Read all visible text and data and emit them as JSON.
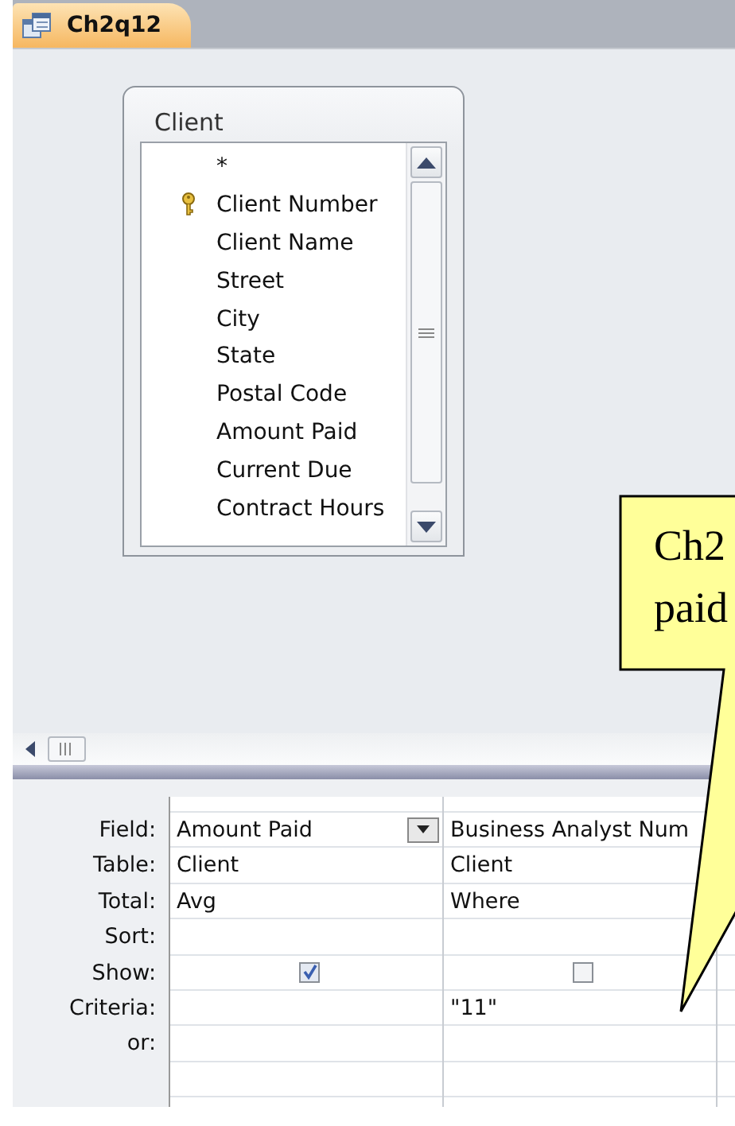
{
  "document_tab": {
    "title": "Ch2q12",
    "selected": true
  },
  "table_box": {
    "title": "Client",
    "fields": [
      {
        "name": "*",
        "primary_key": false
      },
      {
        "name": "Client Number",
        "primary_key": true
      },
      {
        "name": "Client Name",
        "primary_key": false
      },
      {
        "name": "Street",
        "primary_key": false
      },
      {
        "name": "City",
        "primary_key": false
      },
      {
        "name": "State",
        "primary_key": false
      },
      {
        "name": "Postal Code",
        "primary_key": false
      },
      {
        "name": "Amount Paid",
        "primary_key": false
      },
      {
        "name": "Current Due",
        "primary_key": false
      },
      {
        "name": "Contract Hours",
        "primary_key": false
      }
    ]
  },
  "callout": {
    "lines": [
      "Ch2",
      "paid"
    ]
  },
  "grid": {
    "row_labels": [
      "Field:",
      "Table:",
      "Total:",
      "Sort:",
      "Show:",
      "Criteria:",
      "or:"
    ],
    "columns": [
      {
        "field": "Amount Paid",
        "dropdown": true,
        "table": "Client",
        "total": "Avg",
        "show": true
      },
      {
        "field": "Business Analyst Num",
        "dropdown": false,
        "table": "Client",
        "total": "Where",
        "show": false,
        "criteria": "\"11\""
      }
    ]
  }
}
